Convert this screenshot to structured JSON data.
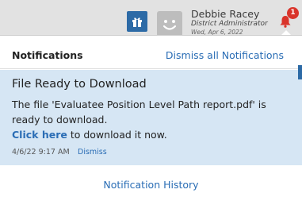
{
  "user": {
    "name": "Debbie Racey",
    "role": "District Administrator",
    "date": "Wed, Apr 6, 2022"
  },
  "bell": {
    "badge_count": "1",
    "badge_color": "#d9342b"
  },
  "notifications_panel": {
    "title": "Notifications",
    "dismiss_all_label": "Dismiss all Notifications",
    "items": [
      {
        "title": "File Ready to Download",
        "body": "The file 'Evaluatee Position Level Path report.pdf' is ready to download.",
        "link_label": "Click here",
        "link_suffix": " to download it now.",
        "timestamp": "4/6/22 9:17 AM",
        "dismiss_label": "Dismiss"
      }
    ],
    "history_label": "Notification History"
  },
  "colors": {
    "accent": "#2a6db5",
    "highlight_bg": "#d6e6f4",
    "gift_button_bg": "#2c6aa6"
  }
}
